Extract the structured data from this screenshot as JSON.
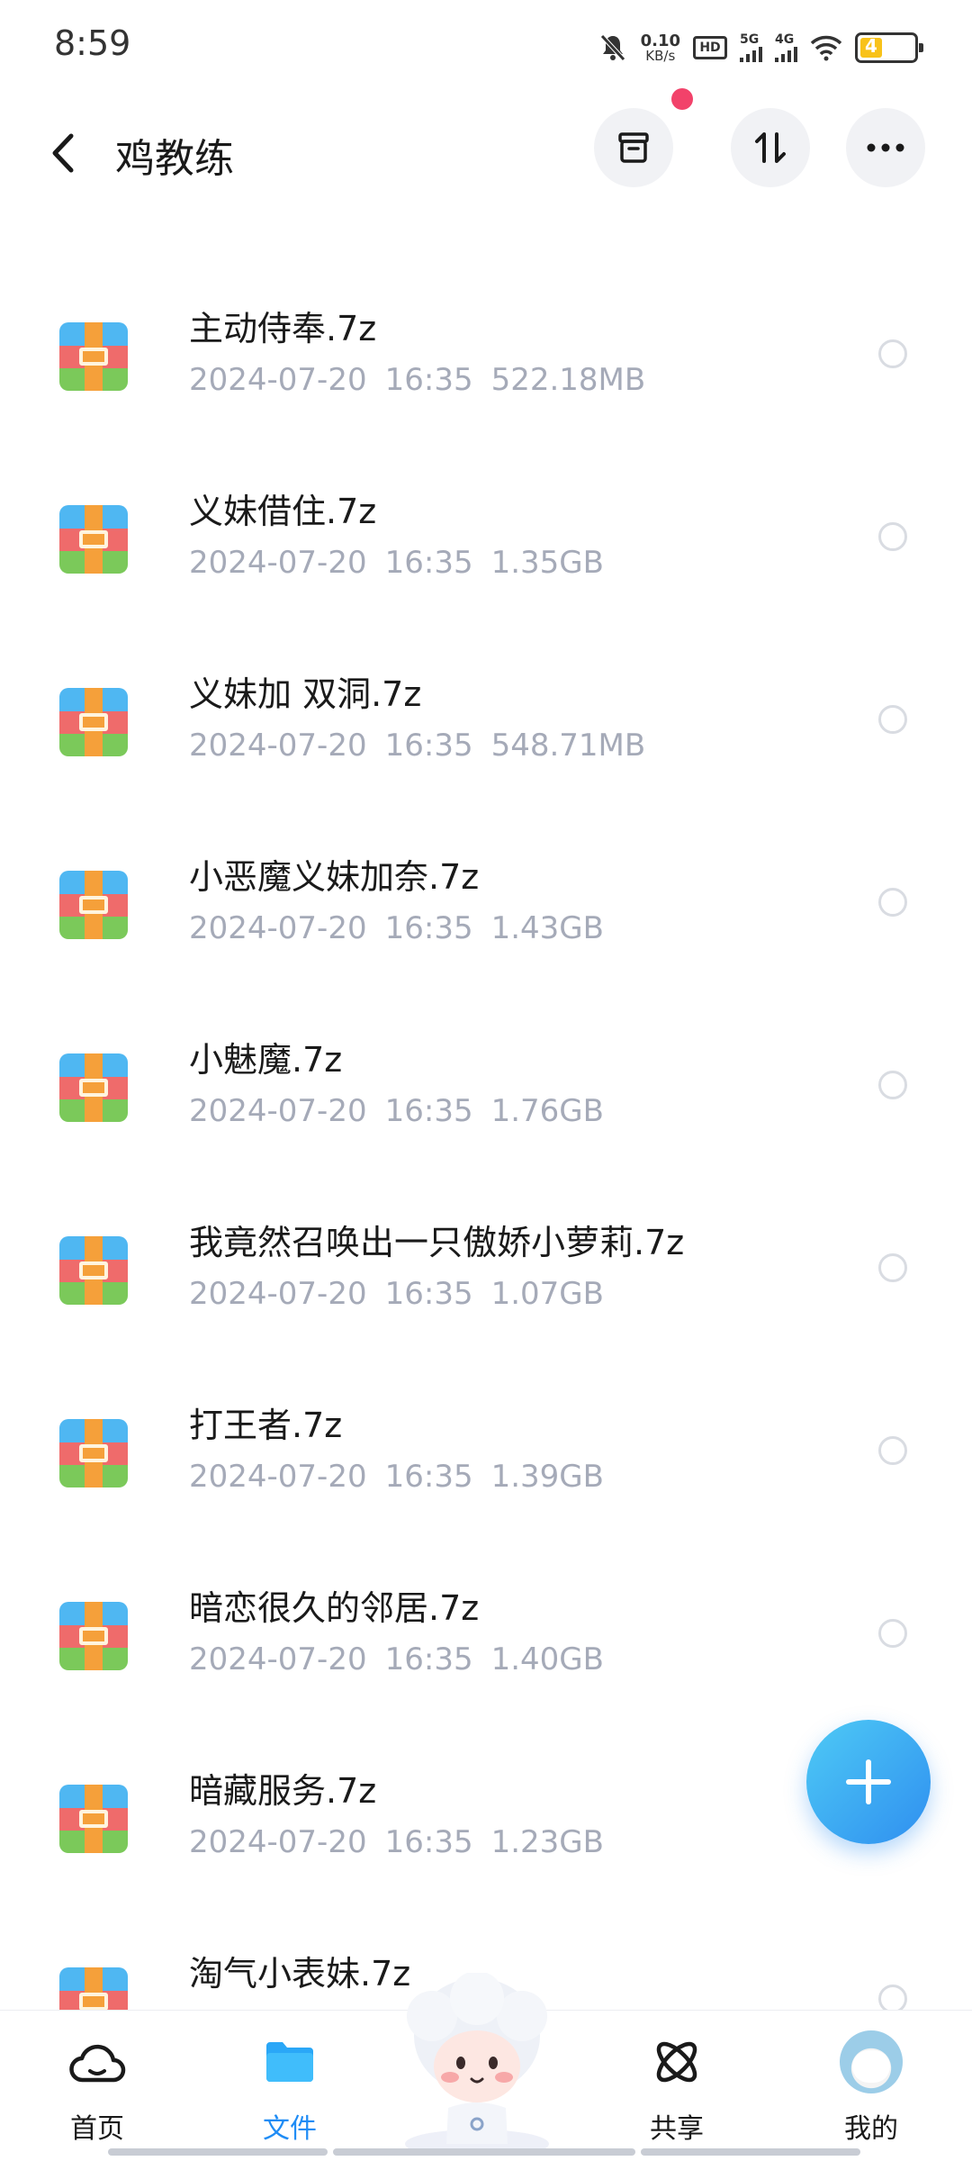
{
  "status": {
    "time": "8:59",
    "speed_value": "0.10",
    "speed_unit": "KB/s",
    "hd_label": "HD",
    "net1": "5G",
    "net2": "4G",
    "battery": "4"
  },
  "header": {
    "title": "鸡教练"
  },
  "files": [
    {
      "name": "主动侍奉.7z",
      "date": "2024-07-20",
      "time": "16:35",
      "size": "522.18MB"
    },
    {
      "name": "义妹借住.7z",
      "date": "2024-07-20",
      "time": "16:35",
      "size": "1.35GB"
    },
    {
      "name": "义妹加 双洞.7z",
      "date": "2024-07-20",
      "time": "16:35",
      "size": "548.71MB"
    },
    {
      "name": "小恶魔义妹加奈.7z",
      "date": "2024-07-20",
      "time": "16:35",
      "size": "1.43GB"
    },
    {
      "name": "小魅魔.7z",
      "date": "2024-07-20",
      "time": "16:35",
      "size": "1.76GB"
    },
    {
      "name": "我竟然召唤出一只傲娇小萝莉.7z",
      "date": "2024-07-20",
      "time": "16:35",
      "size": "1.07GB"
    },
    {
      "name": "打王者.7z",
      "date": "2024-07-20",
      "time": "16:35",
      "size": "1.39GB"
    },
    {
      "name": "暗恋很久的邻居.7z",
      "date": "2024-07-20",
      "time": "16:35",
      "size": "1.40GB"
    },
    {
      "name": "暗藏服务.7z",
      "date": "2024-07-20",
      "time": "16:35",
      "size": "1.23GB"
    },
    {
      "name": "淘气小表妹.7z",
      "date": "",
      "time": "",
      "size": ""
    }
  ],
  "nav": {
    "home": "首页",
    "files": "文件",
    "share": "共享",
    "mine": "我的"
  },
  "colors": {
    "accent": "#1f8cf5",
    "notification_dot": "#f2426a",
    "meta_text": "#a5aab8"
  }
}
